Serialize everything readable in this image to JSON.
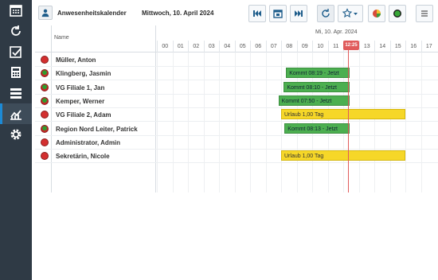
{
  "rail": {
    "items": [
      {
        "name": "calendar-icon"
      },
      {
        "name": "refresh-icon"
      },
      {
        "name": "calendar-check-icon"
      },
      {
        "name": "calculator-icon"
      },
      {
        "name": "list-icon"
      },
      {
        "name": "chart-icon"
      },
      {
        "name": "gear-icon"
      }
    ],
    "active_index": 5
  },
  "toolbar": {
    "title": "Anwesenheitskalender",
    "date": "Mittwoch, 10. April 2024"
  },
  "grid": {
    "name_header": "Name",
    "date_header": "Mi, 10. Apr. 2024",
    "hours": [
      "00",
      "01",
      "02",
      "03",
      "04",
      "05",
      "06",
      "07",
      "08",
      "09",
      "10",
      "11",
      "12",
      "13",
      "14",
      "15",
      "16",
      "17"
    ],
    "now_time": "12:25",
    "rows": [
      {
        "name": "Müller, Anton",
        "status": "red"
      },
      {
        "name": "Klingberg, Jasmin",
        "status": "green",
        "bar": {
          "label": "Kommt 08:19 - Jetzt",
          "type": "green",
          "start": 8.32,
          "end": 12.42
        }
      },
      {
        "name": "VG Filiale 1, Jan",
        "status": "green",
        "bar": {
          "label": "Kommt 08:10 - Jetzt",
          "type": "green",
          "start": 8.17,
          "end": 12.42
        }
      },
      {
        "name": "Kemper, Werner",
        "status": "green",
        "bar": {
          "label": "Kommt 07:50 - Jetzt",
          "type": "green",
          "start": 7.83,
          "end": 12.42
        }
      },
      {
        "name": "VG Filiale 2, Adam",
        "status": "red",
        "bar": {
          "label": "Urlaub 1,00 Tag",
          "type": "yellow",
          "start": 8.0,
          "end": 16.0
        }
      },
      {
        "name": "Region Nord Leiter, Patrick",
        "status": "green",
        "bar": {
          "label": "Kommt 08:13 - Jetzt",
          "type": "green",
          "start": 8.22,
          "end": 12.42
        }
      },
      {
        "name": "Administrator, Admin",
        "status": "red"
      },
      {
        "name": "Sekretärin, Nicole",
        "status": "red",
        "bar": {
          "label": "Urlaub 1,00 Tag",
          "type": "yellow",
          "start": 8.0,
          "end": 16.0
        }
      }
    ]
  },
  "colors": {
    "rail_bg": "#2f3a45",
    "accent": "#1c8ad6",
    "present_green": "#4caf50",
    "vacation_yellow": "#f6d728",
    "now_red": "#e05b5b"
  }
}
